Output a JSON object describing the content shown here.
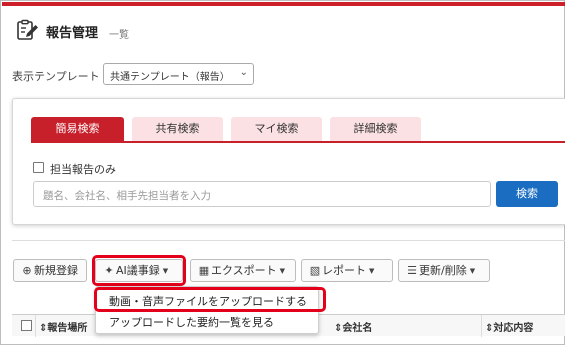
{
  "page": {
    "title": "報告管理",
    "subtitle": "一覧",
    "header_icon": "report-edit-icon",
    "accent_color": "#cc1f2a"
  },
  "template": {
    "label": "表示テンプレート",
    "selected": "共通テンプレート（報告）"
  },
  "search": {
    "tabs": [
      {
        "label": "簡易検索",
        "active": true
      },
      {
        "label": "共有検索",
        "active": false
      },
      {
        "label": "マイ検索",
        "active": false
      },
      {
        "label": "詳細検索",
        "active": false
      }
    ],
    "only_mine_label": "担当報告のみ",
    "only_mine_checked": false,
    "placeholder": "題名、会社名、相手先担当者を入力",
    "button_label": "検索",
    "button_color": "#1b6dc1"
  },
  "toolbar": {
    "new_label": "新規登録",
    "ai_label": "AI議事録",
    "export_label": "エクスポート",
    "report_label": "レポート",
    "update_label": "更新/削除"
  },
  "ai_menu": {
    "items": [
      "動画・音声ファイルをアップロードする",
      "アップロードした要約一覧を見る"
    ]
  },
  "table": {
    "columns": [
      "報告場所",
      "会社名",
      "対応内容"
    ]
  }
}
